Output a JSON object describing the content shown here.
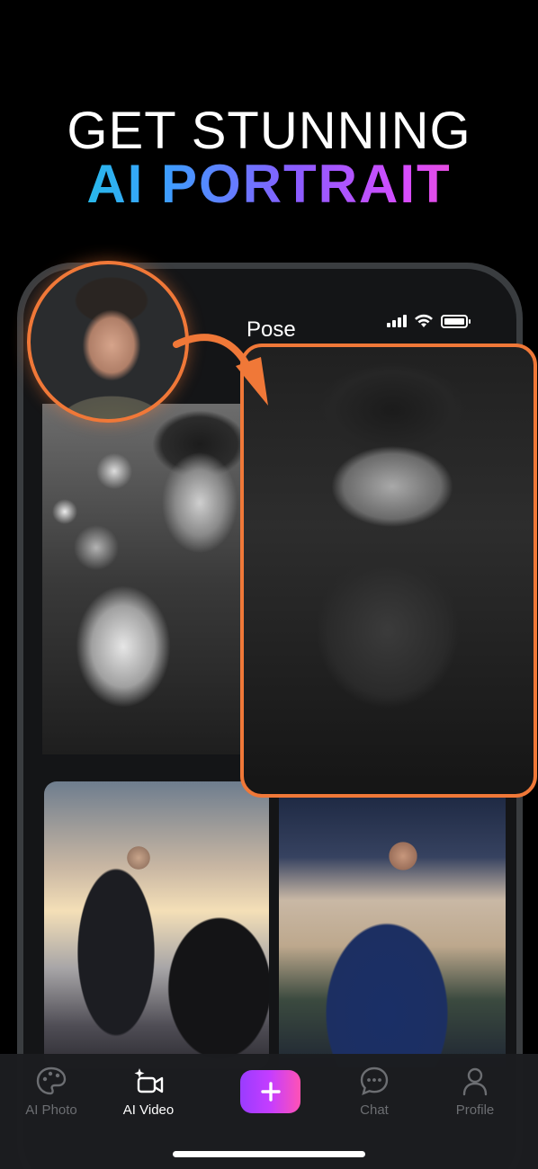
{
  "headline": {
    "line1": "GET STUNNING",
    "line2": "AI PORTRAIT"
  },
  "screen": {
    "title": "Pose"
  },
  "tabbar": {
    "items": [
      {
        "label": "AI Photo",
        "icon": "palette-icon",
        "active": false
      },
      {
        "label": "AI Video",
        "icon": "video-camera-sparkle-icon",
        "active": true
      },
      {
        "label": "Chat",
        "icon": "chat-bubble-icon",
        "active": false
      },
      {
        "label": "Profile",
        "icon": "person-icon",
        "active": false
      }
    ],
    "create_icon": "plus-icon"
  },
  "colors": {
    "accent_orange": "#f07838",
    "gradient_start": "#14d4d0",
    "gradient_end": "#ff4fa6",
    "plus_gradient_start": "#9a3cff",
    "plus_gradient_end": "#ff52b5"
  }
}
